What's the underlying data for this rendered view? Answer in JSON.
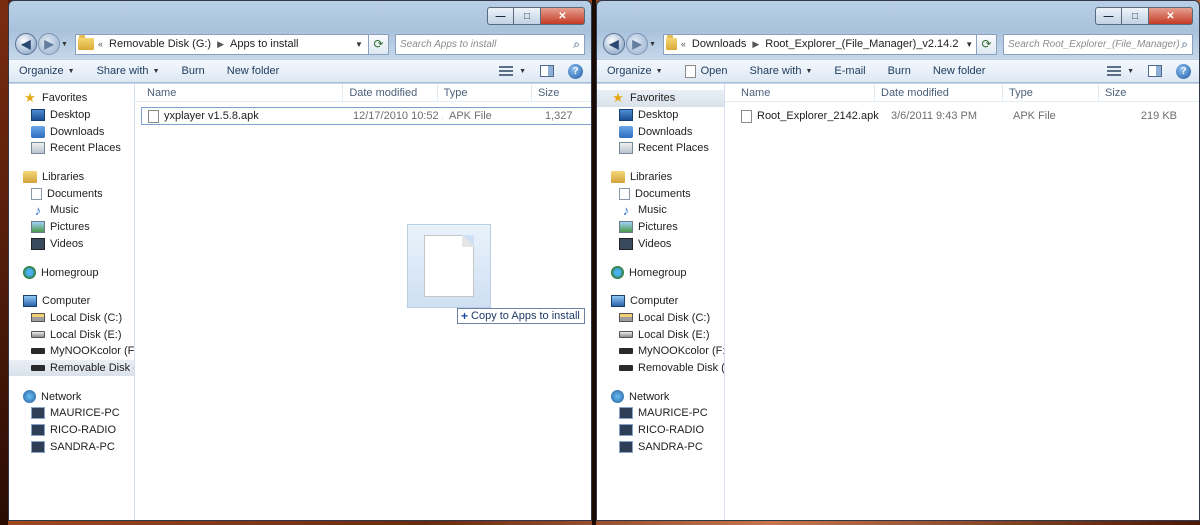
{
  "left_window": {
    "breadcrumb": [
      "Removable Disk (G:)",
      "Apps to install"
    ],
    "search_placeholder": "Search Apps to install",
    "toolbar": {
      "organize": "Organize",
      "share_with": "Share with",
      "burn": "Burn",
      "new_folder": "New folder"
    },
    "columns": [
      "Name",
      "Date modified",
      "Type",
      "Size"
    ],
    "files": [
      {
        "name": "yxplayer v1.5.8.apk",
        "date": "12/17/2010 10:52 ...",
        "type": "APK File",
        "size": "1,327"
      }
    ],
    "drag_tooltip": "Copy to Apps to install"
  },
  "right_window": {
    "breadcrumb": [
      "Downloads",
      "Root_Explorer_(File_Manager)_v2.14.2"
    ],
    "search_placeholder": "Search Root_Explorer_(File_Manager)_...",
    "toolbar": {
      "organize": "Organize",
      "open": "Open",
      "share_with": "Share with",
      "email": "E-mail",
      "burn": "Burn",
      "new_folder": "New folder"
    },
    "columns": [
      "Name",
      "Date modified",
      "Type",
      "Size"
    ],
    "files": [
      {
        "name": "Root_Explorer_2142.apk",
        "date": "3/6/2011 9:43 PM",
        "type": "APK File",
        "size": "219 KB"
      }
    ]
  },
  "nav": {
    "favorites": "Favorites",
    "desktop": "Desktop",
    "downloads": "Downloads",
    "recent_places": "Recent Places",
    "libraries": "Libraries",
    "documents": "Documents",
    "music": "Music",
    "pictures": "Pictures",
    "videos": "Videos",
    "homegroup": "Homegroup",
    "computer": "Computer",
    "local_c": "Local Disk (C:)",
    "local_e": "Local Disk (E:)",
    "nook": "MyNOOKcolor (F:)",
    "removable_g": "Removable Disk (G:)",
    "network": "Network",
    "pc1": "MAURICE-PC",
    "pc2": "RICO-RADIO",
    "pc3": "SANDRA-PC"
  }
}
